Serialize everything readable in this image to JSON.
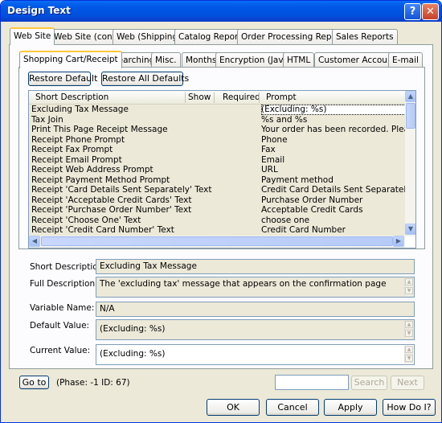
{
  "window": {
    "title": "Design Text",
    "help_label": "?",
    "close_label": "✕"
  },
  "top_tabs": [
    {
      "label": "Web Site",
      "active": true
    },
    {
      "label": "Web Site (cont)"
    },
    {
      "label": "Web (Shipping)"
    },
    {
      "label": "Catalog Reports"
    },
    {
      "label": "Order Processing Reports"
    },
    {
      "label": "Sales Reports"
    }
  ],
  "sub_tabs": [
    {
      "label": "Shopping Cart/Receipt",
      "active": true
    },
    {
      "label": "Searching"
    },
    {
      "label": "Misc."
    },
    {
      "label": "Months"
    },
    {
      "label": "Encryption (Java)"
    },
    {
      "label": "HTML"
    },
    {
      "label": "Customer Accounts"
    },
    {
      "label": "E-mail"
    }
  ],
  "buttons": {
    "restore_default": "Restore Default",
    "restore_all_defaults": "Restore All Defaults"
  },
  "grid": {
    "columns": [
      "Short Description",
      "Show",
      "Required",
      "Prompt"
    ],
    "rows": [
      {
        "desc": "Excluding Tax Message",
        "prompt": "(Excluding: %s)",
        "selected": true
      },
      {
        "desc": "Tax Join",
        "prompt": "%s and %s"
      },
      {
        "desc": "Print This Page Receipt Message",
        "prompt": "Your order has been recorded.  Please fill"
      },
      {
        "desc": "Receipt Phone Prompt",
        "prompt": "Phone"
      },
      {
        "desc": "Receipt Fax Prompt",
        "prompt": "Fax"
      },
      {
        "desc": "Receipt Email Prompt",
        "prompt": "Email"
      },
      {
        "desc": "Receipt Web Address Prompt",
        "prompt": "URL"
      },
      {
        "desc": "Receipt Payment Method Prompt",
        "prompt": "Payment method"
      },
      {
        "desc": "Receipt 'Card Details Sent Separately' Text",
        "prompt": "Credit Card Details Sent Separately"
      },
      {
        "desc": "Receipt 'Acceptable Credit Cards' Text",
        "prompt": "Purchase Order Number"
      },
      {
        "desc": "Receipt 'Purchase Order Number' Text",
        "prompt": "Acceptable Credit Cards"
      },
      {
        "desc": "Receipt 'Choose One' Text",
        "prompt": "choose one"
      },
      {
        "desc": "Receipt 'Credit Card Number' Text",
        "prompt": "Credit Card Number"
      }
    ]
  },
  "details": {
    "short_description_label": "Short Description:",
    "short_description_value": "Excluding Tax Message",
    "full_description_label": "Full Description:",
    "full_description_value": "The 'excluding tax' message that appears on the confirmation page",
    "variable_name_label": "Variable Name:",
    "variable_name_value": "N/A",
    "default_value_label": "Default Value:",
    "default_value_value": "(Excluding: %s)",
    "current_value_label": "Current Value:",
    "current_value_value": "(Excluding: %s)"
  },
  "bottom": {
    "goto_label": "Go to",
    "phase_text": "(Phase: -1    ID: 67)",
    "search_placeholder": "",
    "search_label": "Search",
    "next_label": "Next",
    "ok_label": "OK",
    "cancel_label": "Cancel",
    "apply_label": "Apply",
    "howdoi_label": "How Do I?"
  }
}
